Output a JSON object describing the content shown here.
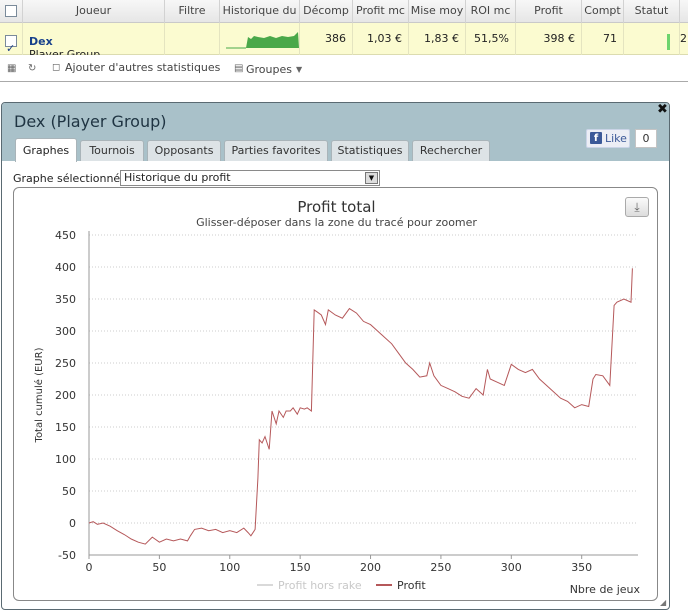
{
  "table": {
    "headers": [
      "Joueur",
      "Filtre",
      "Historique du",
      "Décomp",
      "Profit mc",
      "Mise moy",
      "ROI mc",
      "Profit",
      "Compt",
      "Statut"
    ],
    "row": {
      "name": "Dex",
      "group": "Player Group",
      "filter": "",
      "decompte": "386",
      "profit_moyen": "1,03 €",
      "mise_moyenne": "1,83 €",
      "roi_moyen": "51,5%",
      "profit": "398 €",
      "compte": "71",
      "trailing": "2"
    }
  },
  "toolbar": {
    "add_stats_label": "Ajouter d'autres statistiques",
    "groups_label": "Groupes"
  },
  "dialog": {
    "title": "Dex (Player Group)",
    "like_label": "Like",
    "like_count": "0",
    "tabs": [
      "Graphes",
      "Tournois",
      "Opposants",
      "Parties favorites",
      "Statistiques",
      "Rechercher"
    ],
    "active_tab": "Graphes",
    "graph_select_label": "Graphe sélectionné :",
    "graph_select_value": "Historique du profit"
  },
  "chart_data": {
    "type": "line",
    "title": "Profit total",
    "subtitle": "Glisser-déposer dans la zone du tracé pour zoomer",
    "xlabel": "Nbre de jeux",
    "ylabel": "Total cumulé (EUR)",
    "xlim": [
      0,
      390
    ],
    "ylim": [
      -50,
      450
    ],
    "xticks": [
      0,
      50,
      100,
      150,
      200,
      250,
      300,
      350
    ],
    "yticks": [
      -50,
      0,
      50,
      100,
      150,
      200,
      250,
      300,
      350,
      400,
      450
    ],
    "grid": true,
    "legend_position": "bottom",
    "colors": {
      "profit": "#b5585a",
      "profit_hors_rake": "#d9d9d9",
      "grid": "#cccccc"
    },
    "series": [
      {
        "name": "Profit hors rake",
        "visible": false,
        "x": [],
        "y": []
      },
      {
        "name": "Profit",
        "visible": true,
        "x": [
          0,
          3,
          6,
          10,
          15,
          20,
          25,
          30,
          35,
          40,
          45,
          50,
          55,
          60,
          65,
          70,
          72,
          75,
          80,
          85,
          90,
          95,
          100,
          105,
          110,
          113,
          115,
          118,
          120,
          121,
          123,
          125,
          128,
          130,
          133,
          135,
          138,
          140,
          143,
          145,
          148,
          150,
          153,
          155,
          158,
          160,
          162,
          165,
          168,
          170,
          175,
          180,
          185,
          190,
          195,
          200,
          205,
          210,
          215,
          220,
          225,
          230,
          235,
          240,
          242,
          245,
          250,
          255,
          260,
          265,
          270,
          275,
          280,
          283,
          285,
          290,
          295,
          300,
          305,
          310,
          315,
          320,
          325,
          330,
          335,
          340,
          345,
          350,
          355,
          358,
          360,
          365,
          370,
          373,
          375,
          380,
          385,
          386
        ],
        "y": [
          0,
          2,
          -2,
          0,
          -5,
          -12,
          -18,
          -25,
          -30,
          -33,
          -22,
          -30,
          -25,
          -28,
          -25,
          -28,
          -20,
          -10,
          -8,
          -12,
          -10,
          -15,
          -12,
          -15,
          -8,
          -15,
          -20,
          -10,
          70,
          130,
          125,
          135,
          115,
          175,
          155,
          175,
          165,
          175,
          175,
          180,
          170,
          180,
          178,
          180,
          175,
          333,
          330,
          325,
          310,
          333,
          325,
          320,
          335,
          328,
          315,
          310,
          300,
          290,
          280,
          265,
          250,
          240,
          228,
          230,
          250,
          230,
          215,
          210,
          205,
          198,
          195,
          210,
          200,
          240,
          225,
          220,
          215,
          248,
          240,
          235,
          240,
          225,
          215,
          205,
          195,
          190,
          180,
          185,
          182,
          225,
          232,
          230,
          215,
          340,
          345,
          350,
          345,
          398
        ]
      }
    ]
  }
}
